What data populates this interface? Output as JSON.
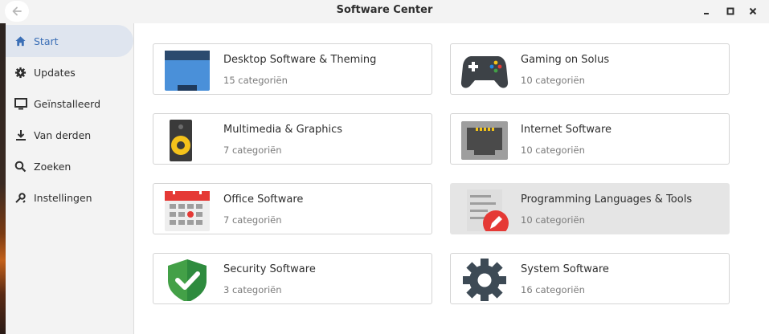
{
  "window": {
    "title": "Software Center",
    "back_icon": "arrow-left-icon",
    "controls": [
      "minimize-icon",
      "maximize-icon",
      "close-icon"
    ]
  },
  "sidebar": {
    "items": [
      {
        "label": "Start",
        "icon": "home-icon",
        "active": true
      },
      {
        "label": "Updates",
        "icon": "gear-update-icon",
        "active": false
      },
      {
        "label": "Geïnstalleerd",
        "icon": "monitor-icon",
        "active": false
      },
      {
        "label": "Van derden",
        "icon": "download-icon",
        "active": false
      },
      {
        "label": "Zoeken",
        "icon": "search-icon",
        "active": false
      },
      {
        "label": "Instellingen",
        "icon": "settings-icon",
        "active": false
      }
    ]
  },
  "categories": [
    {
      "name": "Desktop Software & Theming",
      "sub": "15 categoriën",
      "icon": "desktop-window-icon"
    },
    {
      "name": "Gaming on Solus",
      "sub": "10 categoriën",
      "icon": "gamepad-icon"
    },
    {
      "name": "Multimedia & Graphics",
      "sub": "7 categoriën",
      "icon": "speaker-icon"
    },
    {
      "name": "Internet Software",
      "sub": "10 categoriën",
      "icon": "network-port-icon"
    },
    {
      "name": "Office Software",
      "sub": "7 categoriën",
      "icon": "calendar-icon"
    },
    {
      "name": "Programming Languages & Tools",
      "sub": "10 categoriën",
      "icon": "document-edit-icon"
    },
    {
      "name": "Security Software",
      "sub": "3 categoriën",
      "icon": "shield-check-icon"
    },
    {
      "name": "System Software",
      "sub": "16 categoriën",
      "icon": "cog-icon"
    }
  ],
  "colors": {
    "accent": "#3b6fb6",
    "sidebar_bg": "#f3f3f3",
    "active_bg": "#dfe5ef",
    "card_border": "#d4d4d4",
    "hover_card_bg": "#e5e5e5"
  }
}
